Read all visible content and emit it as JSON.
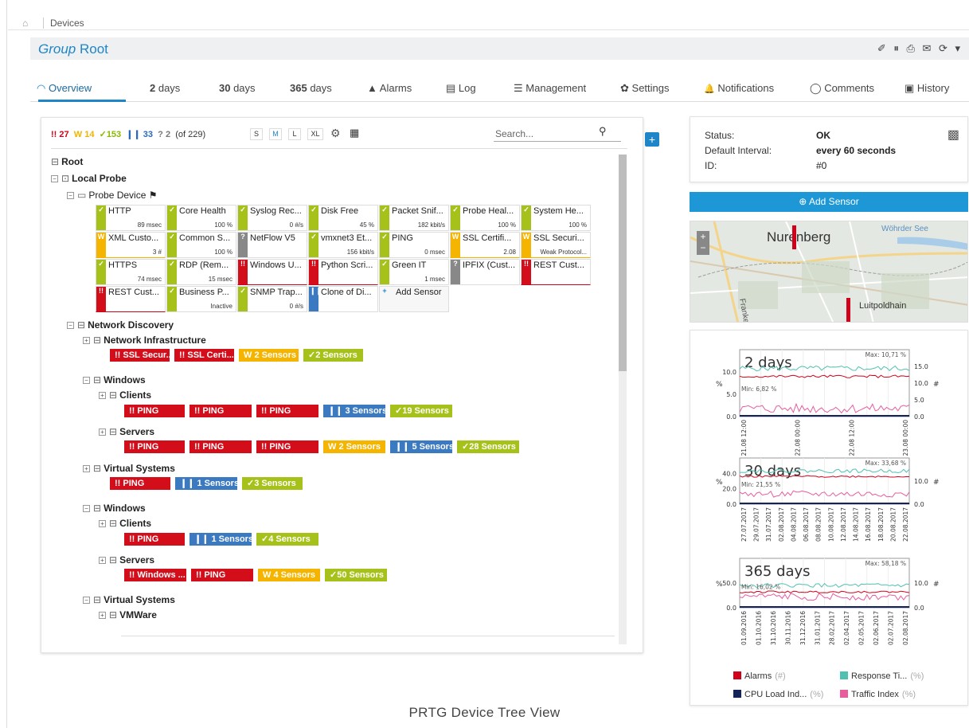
{
  "breadcrumb": {
    "home_icon": "home-icon",
    "item": "Devices"
  },
  "header": {
    "prefix": "Group",
    "name": "Root",
    "tool_icons": "✐ ⏸ ⎙ ✉ ⟳ ▾"
  },
  "tabs": [
    {
      "label": "Overview",
      "icon": "◠"
    },
    {
      "label": "2",
      "label2": " days"
    },
    {
      "label": "30",
      "label2": " days"
    },
    {
      "label": "365",
      "label2": " days"
    },
    {
      "label": "Alarms",
      "icon": "▲"
    },
    {
      "label": "Log",
      "icon": "▤"
    },
    {
      "label": "Management",
      "icon": "☰"
    },
    {
      "label": "Settings",
      "icon": "✿"
    },
    {
      "label": "Notifications",
      "icon": "🔔"
    },
    {
      "label": "Comments",
      "icon": "◯"
    },
    {
      "label": "History",
      "icon": "▣"
    }
  ],
  "filter": {
    "down": "27",
    "warn": "14",
    "up": "153",
    "paused": "33",
    "unknown": "2",
    "total": "(of 229)",
    "sizes": [
      "S",
      "M",
      "L",
      "XL"
    ],
    "search_placeholder": "Search..."
  },
  "tree": {
    "root": "Root",
    "probe": "Local Probe",
    "probe_device": "Probe Device",
    "sensors": [
      {
        "name": "HTTP",
        "value": "89 msec",
        "status": "up"
      },
      {
        "name": "Core Health",
        "value": "100 %",
        "status": "up"
      },
      {
        "name": "Syslog Rec...",
        "value": "0 #/s",
        "status": "up"
      },
      {
        "name": "Disk Free",
        "value": "45 %",
        "status": "up"
      },
      {
        "name": "Packet Snif...",
        "value": "182 kbit/s",
        "status": "up"
      },
      {
        "name": "Probe Heal...",
        "value": "100 %",
        "status": "up"
      },
      {
        "name": "System He...",
        "value": "100 %",
        "status": "up"
      },
      {
        "name": "XML Custo...",
        "value": "3 #",
        "status": "warn"
      },
      {
        "name": "Common S...",
        "value": "100 %",
        "status": "up"
      },
      {
        "name": "NetFlow V5",
        "value": "",
        "status": "unknown"
      },
      {
        "name": "vmxnet3 Et...",
        "value": "156 kbit/s",
        "status": "up"
      },
      {
        "name": "PING",
        "value": "0 msec",
        "status": "up"
      },
      {
        "name": "SSL Certifi...",
        "value": "2.08",
        "status": "warn"
      },
      {
        "name": "SSL Securi...",
        "value": "Weak Protocol...",
        "status": "warn"
      },
      {
        "name": "HTTPS",
        "value": "74 msec",
        "status": "up"
      },
      {
        "name": "RDP (Rem...",
        "value": "15 msec",
        "status": "up"
      },
      {
        "name": "Windows U...",
        "value": "",
        "status": "down"
      },
      {
        "name": "Python Scri...",
        "value": "",
        "status": "down"
      },
      {
        "name": "Green IT",
        "value": "1 msec",
        "status": "up"
      },
      {
        "name": "IPFIX (Cust...",
        "value": "",
        "status": "unknown"
      },
      {
        "name": "REST Cust...",
        "value": "",
        "status": "down"
      },
      {
        "name": "REST Cust...",
        "value": "",
        "status": "down"
      },
      {
        "name": "Business P...",
        "value": "Inactive",
        "status": "up"
      },
      {
        "name": "SNMP Trap...",
        "value": "0 #/s",
        "status": "up"
      },
      {
        "name": "Clone of Di...",
        "value": "",
        "status": "paused"
      }
    ],
    "add_sensor": "Add Sensor",
    "network_discovery": "Network Discovery",
    "network_infrastructure": "Network Infrastructure",
    "ni_groups": [
      {
        "label": "!! SSL Secur...",
        "status": "down"
      },
      {
        "label": "!! SSL Certi...",
        "status": "down"
      },
      {
        "label": "W 2 Sensors",
        "status": "warn"
      },
      {
        "label": "✓2 Sensors",
        "status": "up"
      }
    ],
    "windows": "Windows",
    "clients": "Clients",
    "clients_groups": [
      {
        "label": "!! PING",
        "status": "down"
      },
      {
        "label": "!! PING",
        "status": "down"
      },
      {
        "label": "!! PING",
        "status": "down"
      },
      {
        "label": "❙❙ 3 Sensors",
        "status": "paused"
      },
      {
        "label": "✓19 Sensors",
        "status": "up"
      }
    ],
    "servers": "Servers",
    "servers_groups": [
      {
        "label": "!! PING",
        "status": "down"
      },
      {
        "label": "!! PING",
        "status": "down"
      },
      {
        "label": "!! PING",
        "status": "down"
      },
      {
        "label": "W 2 Sensors",
        "status": "warn"
      },
      {
        "label": "❙❙ 5 Sensors",
        "status": "paused"
      },
      {
        "label": "✓28 Sensors",
        "status": "up"
      }
    ],
    "virtual_systems": "Virtual Systems",
    "vs_groups": [
      {
        "label": "!! PING",
        "status": "down"
      },
      {
        "label": "❙❙ 1 Sensors",
        "status": "paused"
      },
      {
        "label": "✓3 Sensors",
        "status": "up"
      }
    ],
    "windows2": "Windows",
    "clients2": "Clients",
    "clients2_groups": [
      {
        "label": "!! PING",
        "status": "down"
      },
      {
        "label": "❙❙ 1 Sensors",
        "status": "paused"
      },
      {
        "label": "✓4 Sensors",
        "status": "up"
      }
    ],
    "servers2": "Servers",
    "servers2_groups": [
      {
        "label": "!! Windows ...",
        "status": "down"
      },
      {
        "label": "!! PING",
        "status": "down"
      },
      {
        "label": "W 4 Sensors",
        "status": "warn"
      },
      {
        "label": "✓50 Sensors",
        "status": "up"
      }
    ],
    "virtual_systems2": "Virtual Systems",
    "vmware": "VMWare"
  },
  "info": {
    "status_label": "Status:",
    "status_value": "OK",
    "interval_label": "Default Interval:",
    "interval_value": "every  60 seconds",
    "id_label": "ID:",
    "id_value": "#0"
  },
  "add_sensor_button": "Add Sensor",
  "map": {
    "city": "Nurenberg",
    "place1": "Wöhrder See",
    "place2": "Luitpoldhain",
    "street": "Frankensch"
  },
  "chart_data": [
    {
      "type": "line",
      "title": "2 days",
      "x": [
        "21.08 12:00",
        "22.08 00:00",
        "22.08 12:00",
        "23.08 00:00"
      ],
      "ylabel_left": "%",
      "ylabel_right": "#",
      "ylim_left": [
        0,
        13
      ],
      "ylim_right": [
        0,
        18
      ],
      "left_ticks": [
        "0.0",
        "5.0",
        "10.0"
      ],
      "right_ticks": [
        "0.0",
        "5.0",
        "10.0",
        "15.0"
      ],
      "annotations": [
        "Max: 10,71 %",
        "Min: 6,82 %"
      ]
    },
    {
      "type": "line",
      "title": "30 days",
      "x": [
        "27.07.2017",
        "29.07.2017",
        "31.07.2017",
        "02.08.2017",
        "04.08.2017",
        "06.08.2017",
        "08.08.2017",
        "10.08.2017",
        "12.08.2017",
        "14.08.2017",
        "16.08.2017",
        "18.08.2017",
        "20.08.2017",
        "22.08.2017"
      ],
      "ylabel_left": "%",
      "ylabel_right": "#",
      "left_ticks": [
        "0.0",
        "20.0",
        "40.0"
      ],
      "right_ticks": [
        "0.0",
        "10.0"
      ],
      "annotations": [
        "Max: 33,68 %",
        "Min: 21,55 %"
      ]
    },
    {
      "type": "line",
      "title": "365 days",
      "x": [
        "01.09.2016",
        "01.10.2016",
        "31.10.2016",
        "30.11.2016",
        "31.12.2016",
        "31.01.2017",
        "28.02.2017",
        "02.04.2017",
        "02.05.2017",
        "02.06.2017",
        "02.07.2017",
        "02.08.2017"
      ],
      "ylabel_left": "%",
      "ylabel_right": "#",
      "left_ticks": [
        "0.0",
        "50.0"
      ],
      "right_ticks": [
        "0.0",
        "10.0"
      ],
      "annotations": [
        "Max: 58,18 %",
        "Min: 16,02 %"
      ]
    }
  ],
  "legend": [
    {
      "name": "Alarms",
      "unit": "(#)",
      "color": "#d0021b"
    },
    {
      "name": "Response Ti...",
      "unit": "(%)",
      "color": "#4fc1b0"
    },
    {
      "name": "CPU Load Ind...",
      "unit": "(%)",
      "color": "#14235a"
    },
    {
      "name": "Traffic Index",
      "unit": "(%)",
      "color": "#e85c9e"
    }
  ],
  "caption": "PRTG Device Tree View"
}
